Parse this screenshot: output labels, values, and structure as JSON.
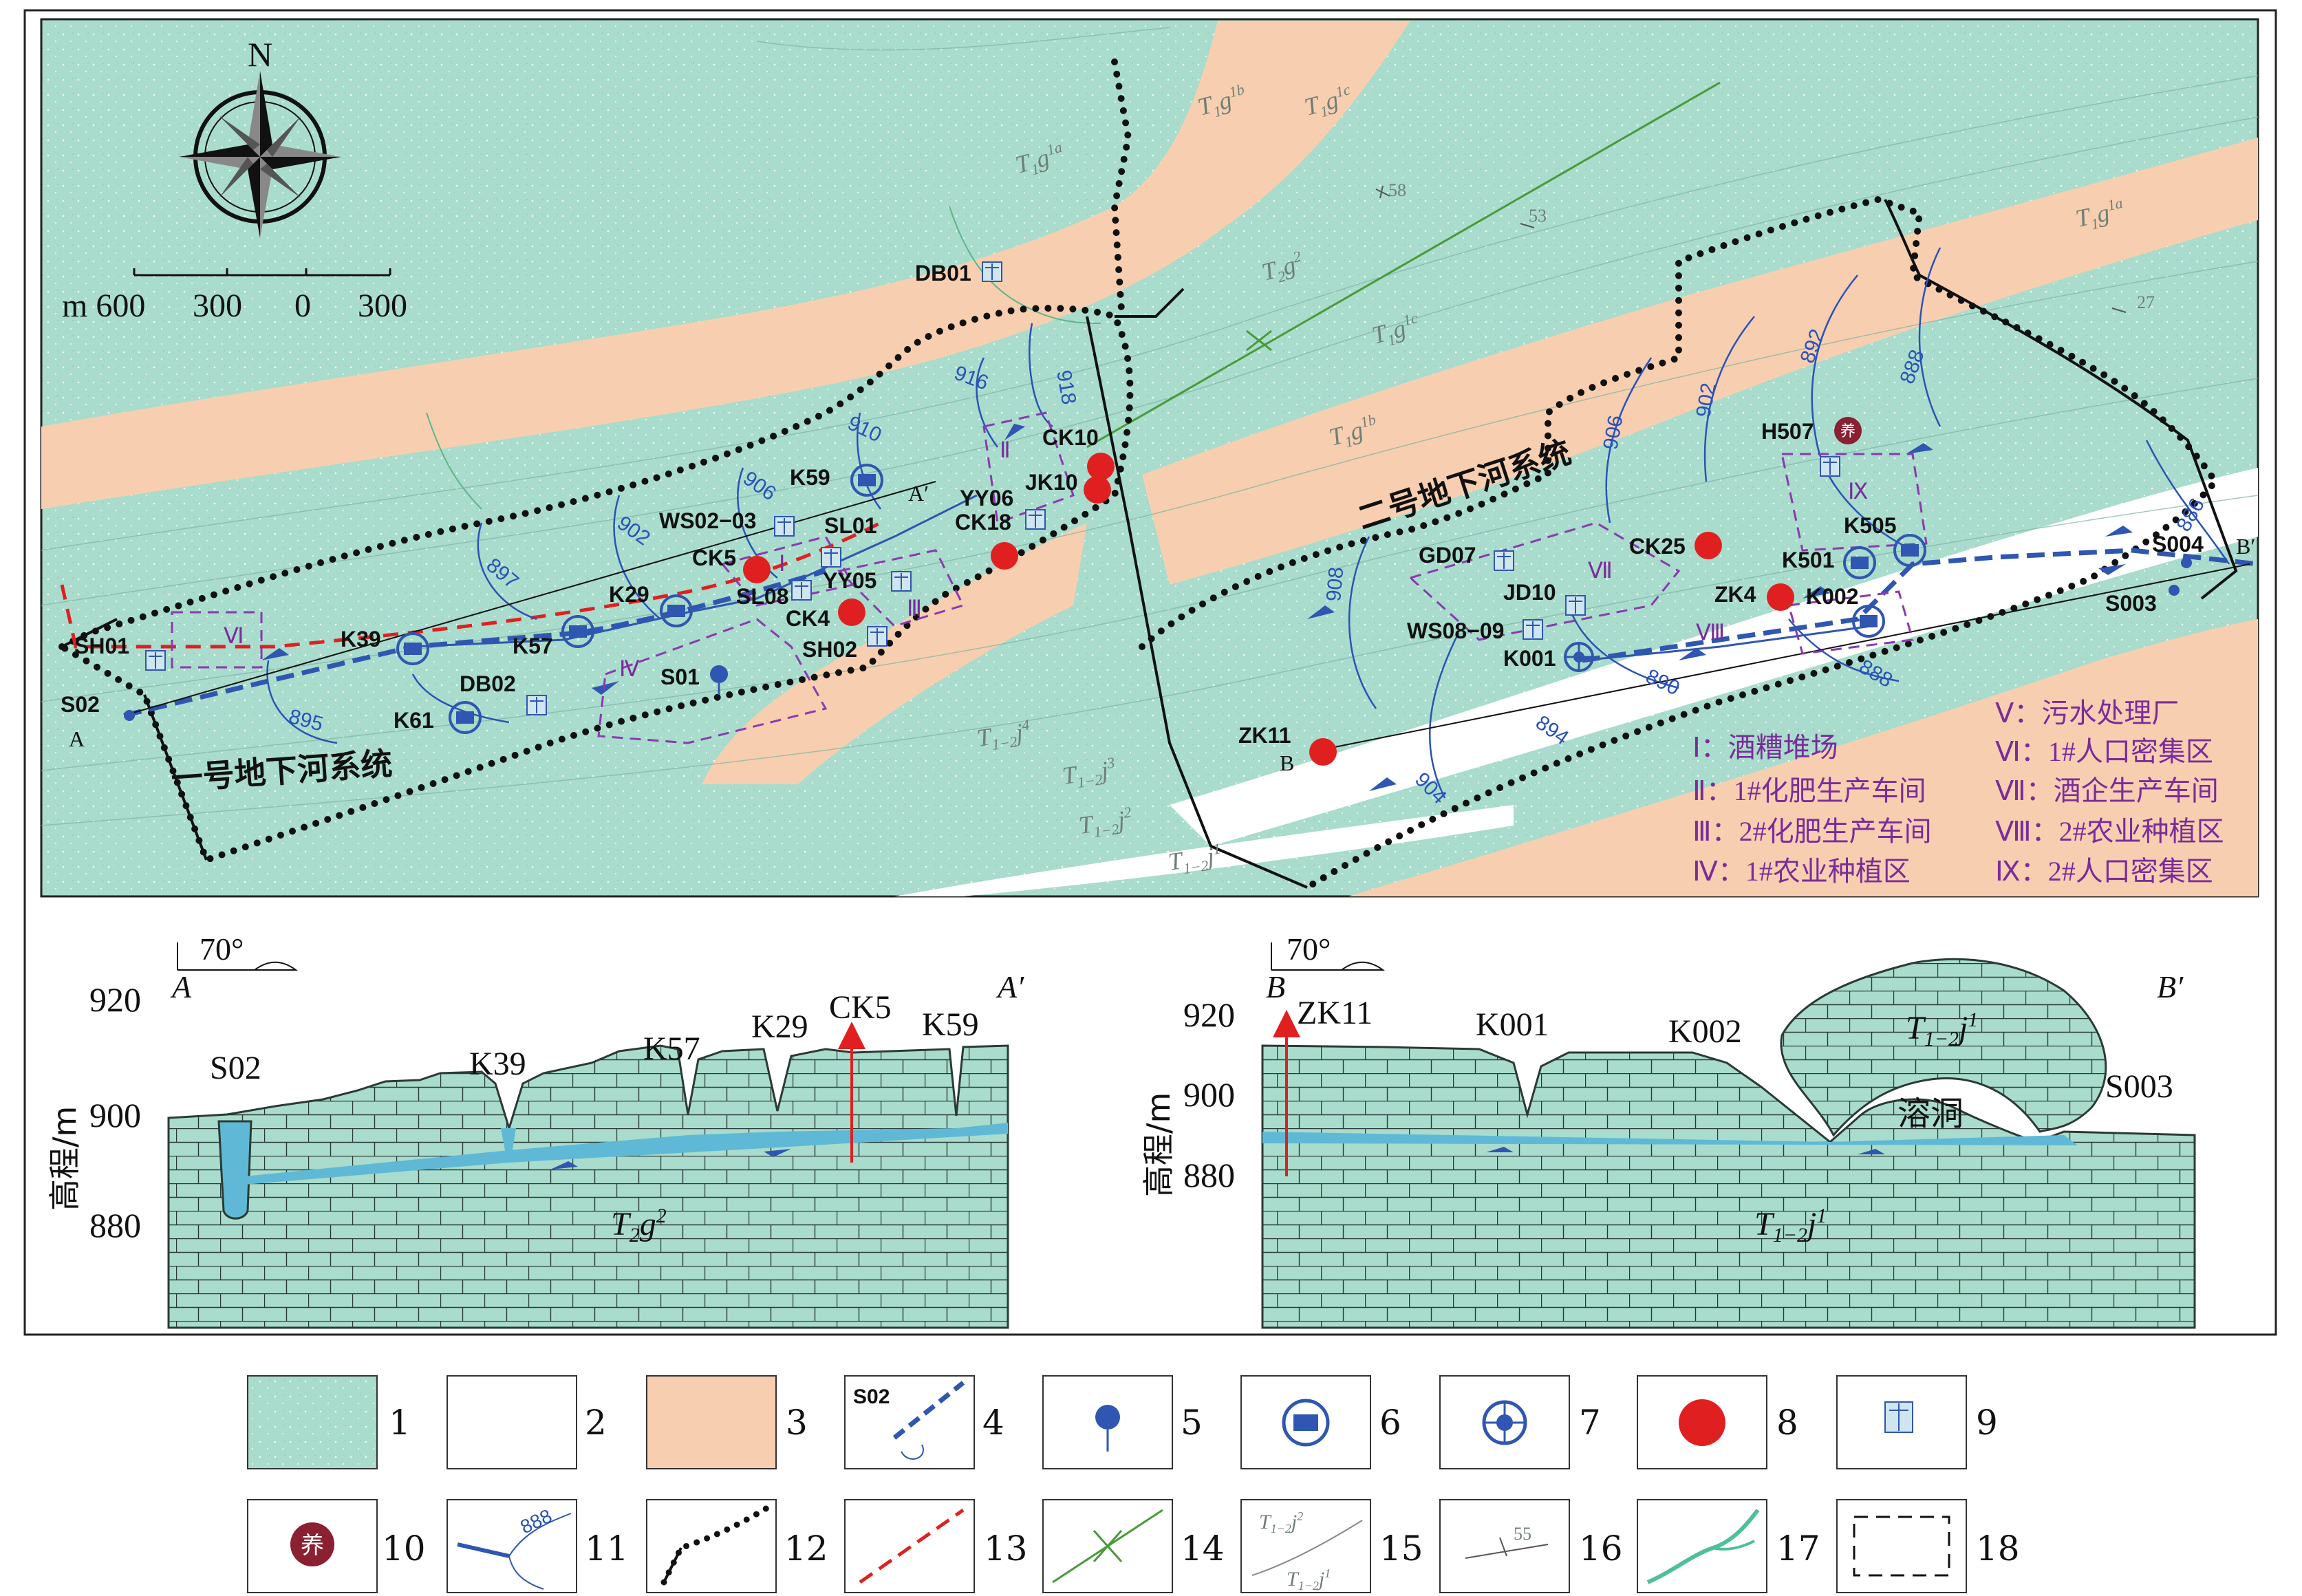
{
  "compass": {
    "north": "N"
  },
  "scale_bar": {
    "labels": [
      "m 600",
      "300",
      "0",
      "300"
    ]
  },
  "systems": {
    "system1": "一号地下河系统",
    "system2": "二号地下河系统"
  },
  "stratigraphy_labels": [
    "T1g1a",
    "T1g1b",
    "T1g1c",
    "T2g2",
    "T1g1c",
    "T1g1b",
    "T1g1a",
    "T1-2j1",
    "T1-2j1",
    "T1-2j2",
    "T1-2j4"
  ],
  "strata_display": {
    "t1g1a": "T",
    "t1g1b": "T",
    "t1g1c": "T",
    "t2g2": "T",
    "t12j": "T"
  },
  "dip_values": [
    "58",
    "53",
    "27"
  ],
  "contours": [
    "916",
    "910",
    "918",
    "906",
    "902",
    "897",
    "895",
    "892",
    "888",
    "902",
    "906",
    "908",
    "890",
    "888",
    "894",
    "904",
    "886"
  ],
  "points": {
    "DB01": "DB01",
    "K59": "K59",
    "WS02_03": "WS02−03",
    "SL01": "SL01",
    "CK5": "CK5",
    "SL08": "SL08",
    "YY05": "YY05",
    "CK4": "CK4",
    "SH02": "SH02",
    "YY06": "YY06",
    "CK18": "CK18",
    "JK10": "JK10",
    "CK10": "CK10",
    "K29": "K29",
    "K57": "K57",
    "K39": "K39",
    "SH01": "SH01",
    "S02": "S02",
    "A": "A",
    "S01": "S01",
    "DB02": "DB02",
    "K61": "K61",
    "Aprime": "A′",
    "H507": "H507",
    "K505": "K505",
    "K501": "K501",
    "S004": "S004",
    "Bprime": "B′",
    "S003": "S003",
    "CK25": "CK25",
    "GD07": "GD07",
    "JD10": "JD10",
    "WS08_09": "WS08−09",
    "ZK4": "ZK4",
    "K002": "K002",
    "K001": "K001",
    "ZK11": "ZK11",
    "B": "B"
  },
  "zones": [
    "Ⅰ",
    "Ⅱ",
    "Ⅲ",
    "Ⅳ",
    "Ⅵ",
    "Ⅶ",
    "Ⅷ",
    "Ⅸ"
  ],
  "zone_legend": [
    "Ⅰ：酒糟堆场",
    "Ⅴ：污水处理厂",
    "Ⅱ：1#化肥生产车间",
    "Ⅵ：1#人口密集区",
    "Ⅲ：2#化肥生产车间",
    "Ⅶ：酒企生产车间",
    "Ⅳ：1#农业种植区",
    "Ⅷ：2#农业种植区",
    "Ⅸ：2#人口密集区"
  ],
  "section_a": {
    "start": "A",
    "end": "A′",
    "dip": "70°",
    "ylabel": "高程/m",
    "yticks": [
      "920",
      "900",
      "880"
    ],
    "labels": [
      "S02",
      "K39",
      "K57",
      "K29",
      "CK5",
      "K59"
    ],
    "strata": "T2g2"
  },
  "section_b": {
    "start": "B",
    "end": "B′",
    "dip": "70°",
    "ylabel": "高程/m",
    "yticks": [
      "920",
      "900",
      "880"
    ],
    "labels": [
      "ZK11",
      "K001",
      "K002",
      "S003"
    ],
    "cave": "溶洞",
    "strata_top": "T1-2j1",
    "strata_bottom": "T1-2j1"
  },
  "legend_numbers": [
    "1",
    "2",
    "3",
    "4",
    "5",
    "6",
    "7",
    "8",
    "9",
    "10",
    "11",
    "12",
    "13",
    "14",
    "15",
    "16",
    "17",
    "18"
  ],
  "legend_inner": {
    "s02": "S02",
    "c888": "888",
    "t12j2": "T",
    "t12j1": "T",
    "dip55": "55"
  },
  "colors": {
    "limestone": "#a9dccc",
    "sand": "#f7cfb0",
    "white_unit": "#ffffff",
    "contour": "#2a52b8",
    "river": "#2f56b0",
    "pollution": "#e02020",
    "zone_border": "#8a3ab0",
    "watershed": "#111111",
    "water": "#5fb9d6"
  }
}
